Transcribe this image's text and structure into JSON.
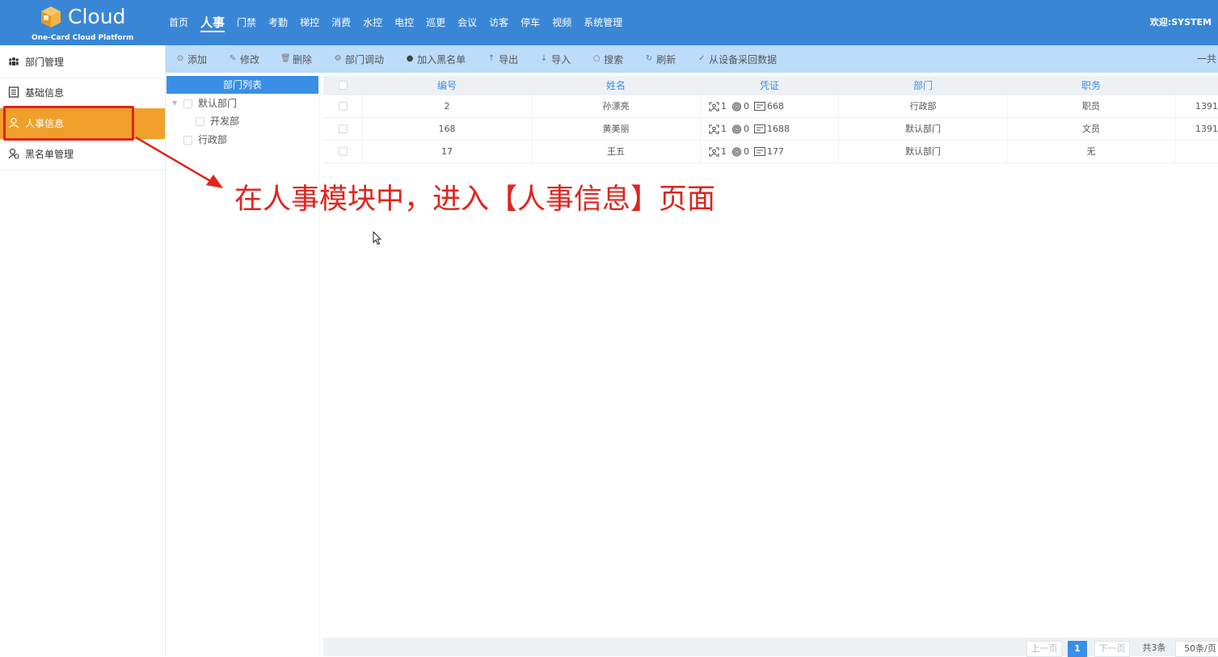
{
  "header": {
    "logo_word": "Cloud",
    "logo_sub": "One-Card Cloud Platform",
    "nav": [
      "首页",
      "人事",
      "门禁",
      "考勤",
      "梯控",
      "消费",
      "水控",
      "电控",
      "巡更",
      "会议",
      "访客",
      "停车",
      "视频",
      "系统管理"
    ],
    "active_nav": "人事",
    "welcome": "欢迎:SYSTEM"
  },
  "sidebar": {
    "items": [
      {
        "label": "部门管理",
        "icon": "people-group-icon"
      },
      {
        "label": "基础信息",
        "icon": "document-list-icon"
      },
      {
        "label": "人事信息",
        "icon": "person-icon",
        "active": true
      },
      {
        "label": "黑名单管理",
        "icon": "person-block-icon"
      }
    ]
  },
  "toolbar": {
    "buttons": [
      {
        "label": "添加",
        "icon": "plus-circle-icon"
      },
      {
        "label": "修改",
        "icon": "pencil-icon"
      },
      {
        "label": "删除",
        "icon": "trash-icon"
      },
      {
        "label": "部门调动",
        "icon": "gear-icon"
      },
      {
        "label": "加入黑名单",
        "icon": "info-circle-icon"
      },
      {
        "label": "导出",
        "icon": "arrow-up-icon"
      },
      {
        "label": "导入",
        "icon": "arrow-down-icon"
      },
      {
        "label": "搜索",
        "icon": "search-icon"
      },
      {
        "label": "刷新",
        "icon": "refresh-icon"
      },
      {
        "label": "从设备采回数据",
        "icon": "check-icon"
      }
    ],
    "total_text": "一共"
  },
  "dept_tree": {
    "header": "部门列表",
    "nodes": [
      {
        "label": "默认部门",
        "level": 0,
        "expanded": true
      },
      {
        "label": "开发部",
        "level": 1
      },
      {
        "label": "行政部",
        "level": 0
      }
    ]
  },
  "table": {
    "columns": [
      "编号",
      "姓名",
      "凭证",
      "部门",
      "职务"
    ],
    "rows": [
      {
        "id": "2",
        "name": "孙漂亮",
        "face": "1",
        "finger": "0",
        "card": "668",
        "dept": "行政部",
        "position": "职员",
        "phone": "1391"
      },
      {
        "id": "168",
        "name": "黄美丽",
        "face": "1",
        "finger": "0",
        "card": "1688",
        "dept": "默认部门",
        "position": "文员",
        "phone": "1391"
      },
      {
        "id": "17",
        "name": "王五",
        "face": "1",
        "finger": "0",
        "card": "177",
        "dept": "默认部门",
        "position": "无",
        "phone": ""
      }
    ]
  },
  "annotation": "在人事模块中，进入【人事信息】页面",
  "pager": {
    "prev": "上一页",
    "current": "1",
    "next": "下一页",
    "total": "共3条",
    "page_size": "50条/页"
  },
  "colors": {
    "header_bg": "#3a86d6",
    "active_menu": "#f0a02a",
    "annotation_red": "#e0241c",
    "toolbar_bg": "#bcdcfa",
    "accent_blue": "#3a8ee6"
  }
}
